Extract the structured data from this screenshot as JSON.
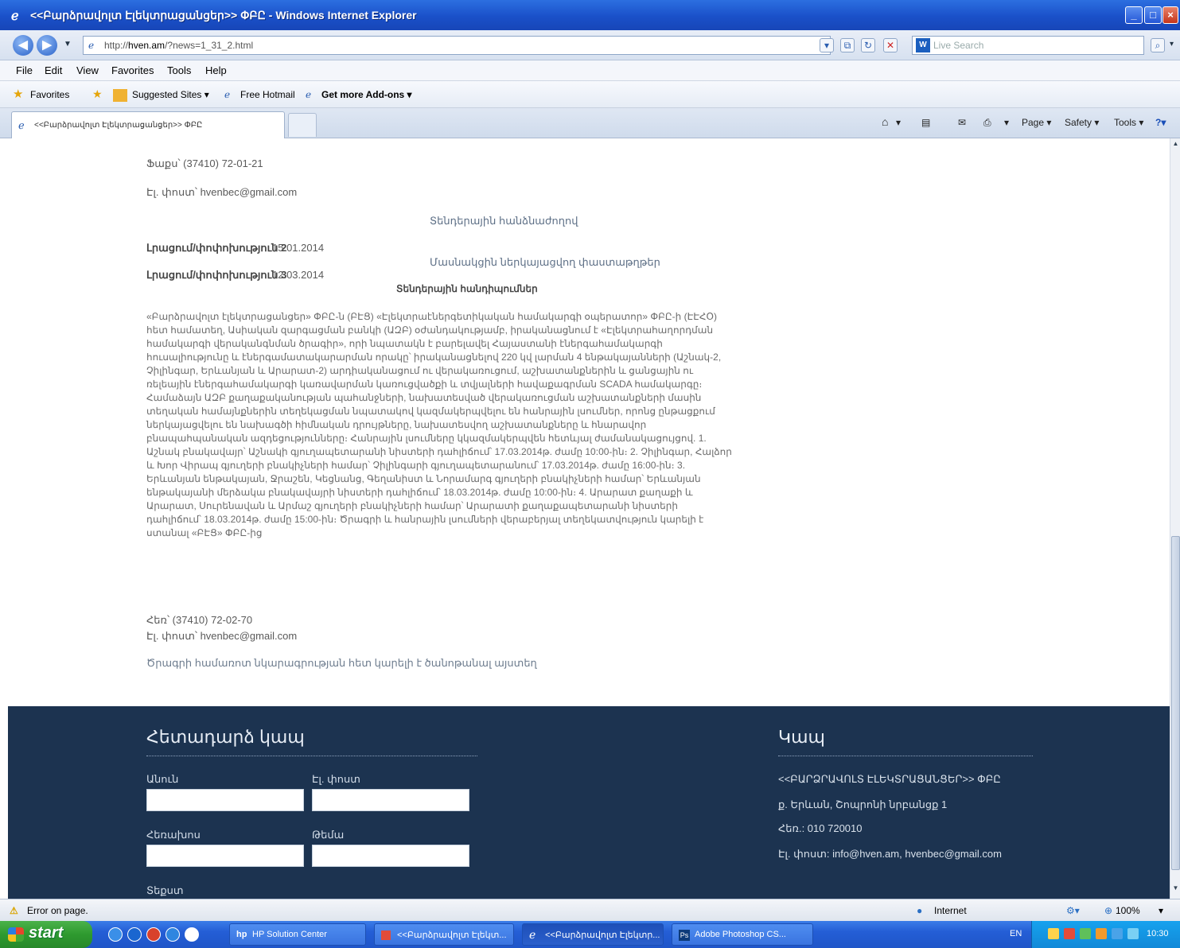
{
  "window": {
    "title": "<<Բարձրավոլտ Էլեկտրացանցեր>> ՓԲԸ - Windows Internet Explorer",
    "minimize": "_",
    "maximize": "□",
    "close": "×"
  },
  "addressbar": {
    "url_prefix": "http://",
    "url_domain": "hven.am",
    "url_rest": "/?news=1_31_2.html",
    "search_placeholder": "Live Search"
  },
  "menubar": {
    "items": [
      "File",
      "Edit",
      "View",
      "Favorites",
      "Tools",
      "Help"
    ]
  },
  "favorites": {
    "label": "Favorites",
    "suggested": "Suggested Sites ▾",
    "hotmail": "Free Hotmail",
    "addons": "Get more Add-ons ▾"
  },
  "tabbar": {
    "active_tab": "<<Բարձրավոլտ Էլեկտրացանցեր>> ՓԲԸ",
    "page_menu": "Page ▾",
    "safety_menu": "Safety ▾",
    "tools_menu": "Tools ▾"
  },
  "content": {
    "fax": "Ֆաքս՝ (37410) 72-01-21",
    "email": "Էլ. փոստ՝ hvenbec@gmail.com",
    "heading_organizer": "Տենդերային հանձնաժողով",
    "amendment2_label": "Լրացում/փոփոխություն 2",
    "amendment2_date": "15.01.2014",
    "amendment3_label": "Լրացում/փոփոխություն 3",
    "amendment3_date": "12.03.2014",
    "heading_clarifications": "Մասնակցին ներկայացվող փաստաթղթեր",
    "heading_meetings": "Տենդերային հանդիպումներ",
    "body": "«Բարձրավոլտ էլեկտրացանցեր» ՓԲԸ-ն (ԲԷՑ) «Էլեկտրաէներգետիկական համակարգի օպերատոր» ՓԲԸ-ի (ԷԷՀՕ) հետ համատեղ, Ասիական զարգացման բանկի (ԱԶԲ) օժանդակությամբ, իրականացնում է «Էլեկտրահաղորդման համակարգի վերականգնման ծրագիր», որի նպատակն է բարելավել Հայաստանի էներգահամակարգի հուսալիությունը և էներգամատակարարման որակը՝ իրականացնելով 220 կվ լարման 4 ենթակայանների (Աշնակ-2, Չիլինգար, Երևանյան և Արարատ-2) արդիականացում ու վերակառուցում, աշխատանքներին և ցանցային ու ռելեային էներգահամակարգի կառավարման կառուցվածքի և տվյալների հավաքագրման SCADA համակարգը։ Համաձայն ԱԶԲ քաղաքականության պահանջների, նախատեսված վերակառուցման աշխատանքների մասին տեղական համայնքներին տեղեկացման նպատակով կազմակերպվելու են հանրային լսումներ, որոնց ընթացքում ներկայացվելու են նախագծի հիմնական դրույթները, նախատեսվող աշխատանքները և հնարավոր բնապահպանական ազդեցությունները։ Հանրային լսումները կկազմակերպվեն հետևյալ ժամանակացույցով. 1. Աշնակ բնակավայր՝ Աշնակի գյուղապետարանի նիստերի դահլիճում՝ 17.03.2014թ. ժամը 10:00-ին։ 2. Չիլինգար, Հալձոր և Խոր Վիրապ գյուղերի բնակիչների համար՝ Չիլինգարի գյուղապետարանում՝ 17.03.2014թ. ժամը 16:00-ին։ 3. Երևանյան ենթակայան, Ջրաշեն, Կեցնանց, Գեղանիստ և Նորամարգ գյուղերի բնակիչների համար՝ Երևանյան ենթակայանի մերձակա բնակավայրի նիստերի դահլիճում՝ 18.03.2014թ. ժամը 10:00-ին։ 4. Արարատ քաղաքի և Արարատ, Սուրենավան և Արմաշ գյուղերի բնակիչների համար՝ Արարատի քաղաքապետարանի նիստերի դահլիճում՝ 18.03.2014թ. ժամը 15:00-ին։ Ծրագրի և հանրային լսումների վերաբերյալ տեղեկատվություն կարելի է ստանալ «ԲԷՑ» ՓԲԸ-ից",
    "phone": "Հեռ՝ (37410) 72-02-70",
    "email2": "Էլ. փոստ՝ hvenbec@gmail.com",
    "more_info": "Ծրագրի համառոտ նկարագրության հետ կարելի է ծանոթանալ այստեղ"
  },
  "footer": {
    "feedback_title": "Հետադարձ կապ",
    "name_label": "Անուն",
    "email_label": "Էլ. փոստ",
    "phone_label": "Հեռախոս",
    "subject_label": "Թեմա",
    "text_label": "Տեքստ",
    "contact_title": "Կապ",
    "company": "<<ԲԱՐՁՐԱՎՈԼՏ ԷԼԵԿՏՐԱՑԱՆՑԵՐ>> ՓԲԸ",
    "address": "ք. Երևան, Շոպրոնի նրբանցք 1",
    "tel": "Հեռ.: 010 720010",
    "contact_email": "Էլ. փոստ: info@hven.am, hvenbec@gmail.com"
  },
  "statusbar": {
    "left": "Error on page.",
    "zone": "Internet",
    "zoom": "100%"
  },
  "taskbar": {
    "start": "start",
    "tasks": [
      "HP Solution Center",
      "<<Բարձրավոլտ Էլեկտ...",
      "<<Բարձրավոլտ Էլեկտր...",
      "Adobe Photoshop CS..."
    ],
    "lang": "EN",
    "clock": "10:30"
  }
}
